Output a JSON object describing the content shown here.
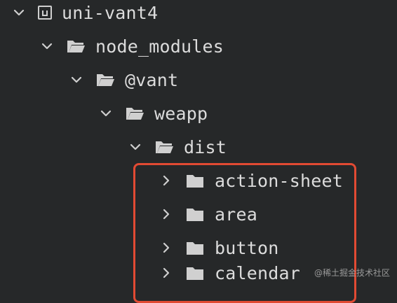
{
  "tree": {
    "items": [
      {
        "label": "uni-vant4",
        "expanded": true,
        "icon": "project-root-icon"
      },
      {
        "label": "node_modules",
        "expanded": true,
        "icon": "folder-open-icon"
      },
      {
        "label": "@vant",
        "expanded": true,
        "icon": "folder-open-icon"
      },
      {
        "label": "weapp",
        "expanded": true,
        "icon": "folder-open-icon"
      },
      {
        "label": "dist",
        "expanded": true,
        "icon": "folder-open-icon"
      },
      {
        "label": "action-sheet",
        "expanded": false,
        "icon": "folder-closed-icon"
      },
      {
        "label": "area",
        "expanded": false,
        "icon": "folder-closed-icon"
      },
      {
        "label": "button",
        "expanded": false,
        "icon": "folder-closed-icon"
      },
      {
        "label": "calendar",
        "expanded": false,
        "icon": "folder-closed-icon"
      }
    ]
  },
  "highlight_color": "#e14a33",
  "watermark": "@稀土掘金技术社区"
}
